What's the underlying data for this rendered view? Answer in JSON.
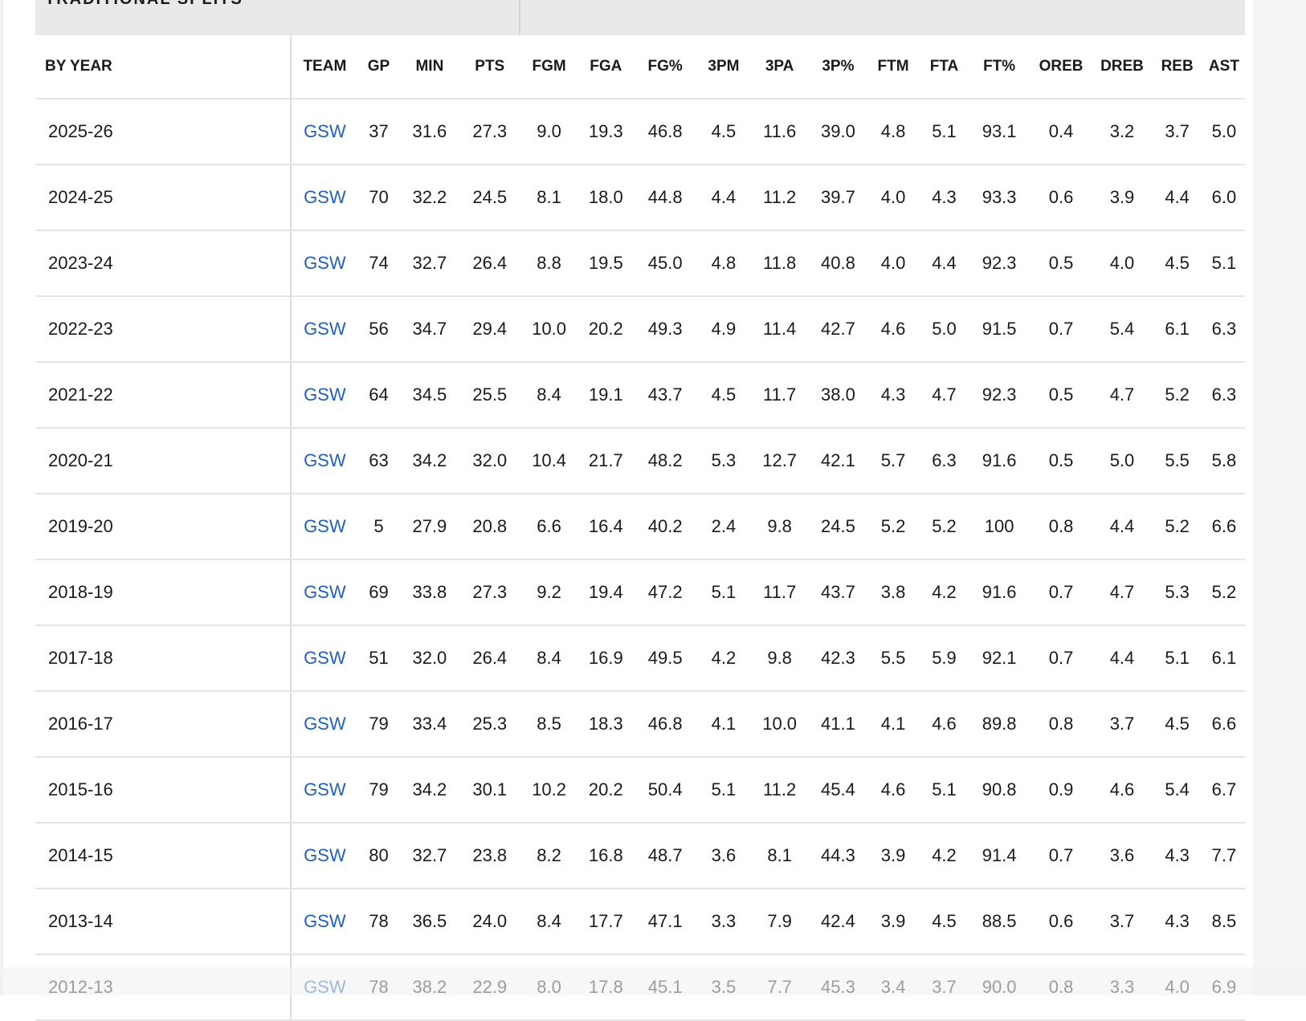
{
  "section": {
    "title": "TRADITIONAL SPLITS"
  },
  "table": {
    "columns": [
      "BY YEAR",
      "TEAM",
      "GP",
      "MIN",
      "PTS",
      "FGM",
      "FGA",
      "FG%",
      "3PM",
      "3PA",
      "3P%",
      "FTM",
      "FTA",
      "FT%",
      "OREB",
      "DREB",
      "REB",
      "AST"
    ],
    "rows": [
      [
        "2025-26",
        "GSW",
        "37",
        "31.6",
        "27.3",
        "9.0",
        "19.3",
        "46.8",
        "4.5",
        "11.6",
        "39.0",
        "4.8",
        "5.1",
        "93.1",
        "0.4",
        "3.2",
        "3.7",
        "5.0"
      ],
      [
        "2024-25",
        "GSW",
        "70",
        "32.2",
        "24.5",
        "8.1",
        "18.0",
        "44.8",
        "4.4",
        "11.2",
        "39.7",
        "4.0",
        "4.3",
        "93.3",
        "0.6",
        "3.9",
        "4.4",
        "6.0"
      ],
      [
        "2023-24",
        "GSW",
        "74",
        "32.7",
        "26.4",
        "8.8",
        "19.5",
        "45.0",
        "4.8",
        "11.8",
        "40.8",
        "4.0",
        "4.4",
        "92.3",
        "0.5",
        "4.0",
        "4.5",
        "5.1"
      ],
      [
        "2022-23",
        "GSW",
        "56",
        "34.7",
        "29.4",
        "10.0",
        "20.2",
        "49.3",
        "4.9",
        "11.4",
        "42.7",
        "4.6",
        "5.0",
        "91.5",
        "0.7",
        "5.4",
        "6.1",
        "6.3"
      ],
      [
        "2021-22",
        "GSW",
        "64",
        "34.5",
        "25.5",
        "8.4",
        "19.1",
        "43.7",
        "4.5",
        "11.7",
        "38.0",
        "4.3",
        "4.7",
        "92.3",
        "0.5",
        "4.7",
        "5.2",
        "6.3"
      ],
      [
        "2020-21",
        "GSW",
        "63",
        "34.2",
        "32.0",
        "10.4",
        "21.7",
        "48.2",
        "5.3",
        "12.7",
        "42.1",
        "5.7",
        "6.3",
        "91.6",
        "0.5",
        "5.0",
        "5.5",
        "5.8"
      ],
      [
        "2019-20",
        "GSW",
        "5",
        "27.9",
        "20.8",
        "6.6",
        "16.4",
        "40.2",
        "2.4",
        "9.8",
        "24.5",
        "5.2",
        "5.2",
        "100",
        "0.8",
        "4.4",
        "5.2",
        "6.6"
      ],
      [
        "2018-19",
        "GSW",
        "69",
        "33.8",
        "27.3",
        "9.2",
        "19.4",
        "47.2",
        "5.1",
        "11.7",
        "43.7",
        "3.8",
        "4.2",
        "91.6",
        "0.7",
        "4.7",
        "5.3",
        "5.2"
      ],
      [
        "2017-18",
        "GSW",
        "51",
        "32.0",
        "26.4",
        "8.4",
        "16.9",
        "49.5",
        "4.2",
        "9.8",
        "42.3",
        "5.5",
        "5.9",
        "92.1",
        "0.7",
        "4.4",
        "5.1",
        "6.1"
      ],
      [
        "2016-17",
        "GSW",
        "79",
        "33.4",
        "25.3",
        "8.5",
        "18.3",
        "46.8",
        "4.1",
        "10.0",
        "41.1",
        "4.1",
        "4.6",
        "89.8",
        "0.8",
        "3.7",
        "4.5",
        "6.6"
      ],
      [
        "2015-16",
        "GSW",
        "79",
        "34.2",
        "30.1",
        "10.2",
        "20.2",
        "50.4",
        "5.1",
        "11.2",
        "45.4",
        "4.6",
        "5.1",
        "90.8",
        "0.9",
        "4.6",
        "5.4",
        "6.7"
      ],
      [
        "2014-15",
        "GSW",
        "80",
        "32.7",
        "23.8",
        "8.2",
        "16.8",
        "48.7",
        "3.6",
        "8.1",
        "44.3",
        "3.9",
        "4.2",
        "91.4",
        "0.7",
        "3.6",
        "4.3",
        "7.7"
      ],
      [
        "2013-14",
        "GSW",
        "78",
        "36.5",
        "24.0",
        "8.4",
        "17.7",
        "47.1",
        "3.3",
        "7.9",
        "42.4",
        "3.9",
        "4.5",
        "88.5",
        "0.6",
        "3.7",
        "4.3",
        "8.5"
      ],
      [
        "2012-13",
        "GSW",
        "78",
        "38.2",
        "22.9",
        "8.0",
        "17.8",
        "45.1",
        "3.5",
        "7.7",
        "45.3",
        "3.4",
        "3.7",
        "90.0",
        "0.8",
        "3.3",
        "4.0",
        "6.9"
      ]
    ]
  },
  "colors": {
    "link": "#1d5fc9",
    "header_bg": "#e8e9eb",
    "row_border": "#e4e4e4"
  }
}
